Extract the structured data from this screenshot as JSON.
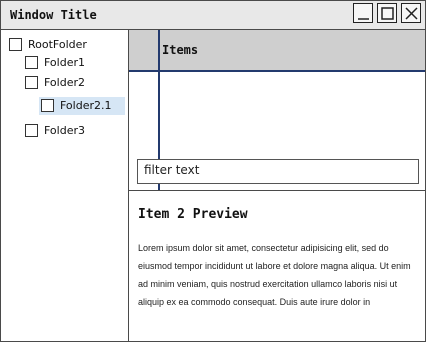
{
  "window": {
    "title": "Window Title",
    "buttons": [
      "minimize-icon",
      "maximize-icon",
      "close-icon"
    ]
  },
  "tree": {
    "items": [
      {
        "label": "RootFolder",
        "level": 0,
        "selected": false
      },
      {
        "label": "Folder1",
        "level": 1,
        "selected": false
      },
      {
        "label": "Folder2",
        "level": 1,
        "selected": false
      },
      {
        "label": "Folder2.1",
        "level": 2,
        "selected": true
      },
      {
        "label": "Folder3",
        "level": 1,
        "selected": false
      }
    ]
  },
  "list": {
    "column_header": "Items"
  },
  "filter": {
    "placeholder": "filter text"
  },
  "preview": {
    "title": "Item 2 Preview",
    "body": "Lorem ipsum dolor sit amet, consectetur adipisicing elit, sed do eiusmod tempor incididunt ut labore et dolore magna aliqua. Ut enim ad minim veniam, quis nostrud exercitation ullamco laboris nisi ut aliquip ex ea commodo consequat. Duis aute irure dolor in"
  },
  "colors": {
    "selection": "#d6e6f5",
    "grid": "#233a6e",
    "header": "#cfcfcf"
  }
}
